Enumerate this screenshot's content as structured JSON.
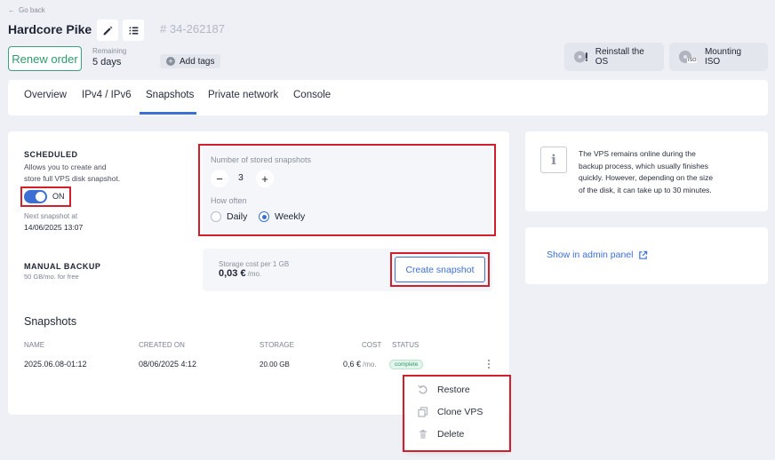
{
  "header": {
    "go_back": "Go back",
    "server_name": "Hardcore Pike",
    "server_id": "# 34-262187",
    "renew_label": "Renew order",
    "remaining_label": "Remaining",
    "remaining_value": "5 days",
    "add_tags_label": "Add tags",
    "reinstall_label": "Reinstall the OS",
    "mounting_label": "Mounting ISO",
    "iso_badge": "ISO"
  },
  "tabs": [
    {
      "label": "Overview",
      "active": false
    },
    {
      "label": "IPv4 / IPv6",
      "active": false
    },
    {
      "label": "Snapshots",
      "active": true
    },
    {
      "label": "Private network",
      "active": false
    },
    {
      "label": "Console",
      "active": false
    }
  ],
  "scheduled": {
    "title": "SCHEDULED",
    "description_line1": "Allows you to create and",
    "description_line2": "store full VPS disk snapshot.",
    "toggle_label": "ON",
    "toggle_on": true,
    "next_label": "Next snapshot at",
    "next_value": "14/06/2025 13:07"
  },
  "settings": {
    "stored_label": "Number of stored snapshots",
    "minus": "−",
    "count": "3",
    "plus": "+",
    "how_often_label": "How often",
    "option_daily": "Daily",
    "option_weekly": "Weekly",
    "selected": "Weekly"
  },
  "manual": {
    "title": "MANUAL BACKUP",
    "subtitle": "50 GB/mo. for free",
    "cost_label": "Storage cost per 1 GB",
    "cost_value": "0,03 €",
    "cost_unit": "/mo.",
    "create_label": "Create snapshot"
  },
  "snapshots": {
    "title": "Snapshots",
    "columns": [
      "NAME",
      "CREATED ON",
      "STORAGE",
      "COST",
      "STATUS"
    ],
    "rows": [
      {
        "name": "2025.06.08-01:12",
        "created": "08/06/2025 4:12",
        "storage": "20.00 GB",
        "cost": "0,6 €",
        "cost_unit": "/mo.",
        "status": "complete"
      }
    ]
  },
  "context_menu": {
    "restore": "Restore",
    "clone": "Clone VPS",
    "delete": "Delete"
  },
  "info": {
    "line1": "The VPS remains online during the",
    "line2": "backup process, which usually finishes",
    "line3": "quickly. However, depending on the size",
    "line4": "of the disk, it can take up to 30 minutes."
  },
  "admin_link": "Show in admin panel",
  "colors": {
    "accent": "#3b6fd4",
    "renew_green": "#2e9a6c",
    "highlight_red": "#d11f2e",
    "status_complete": "#2e9a6c"
  }
}
